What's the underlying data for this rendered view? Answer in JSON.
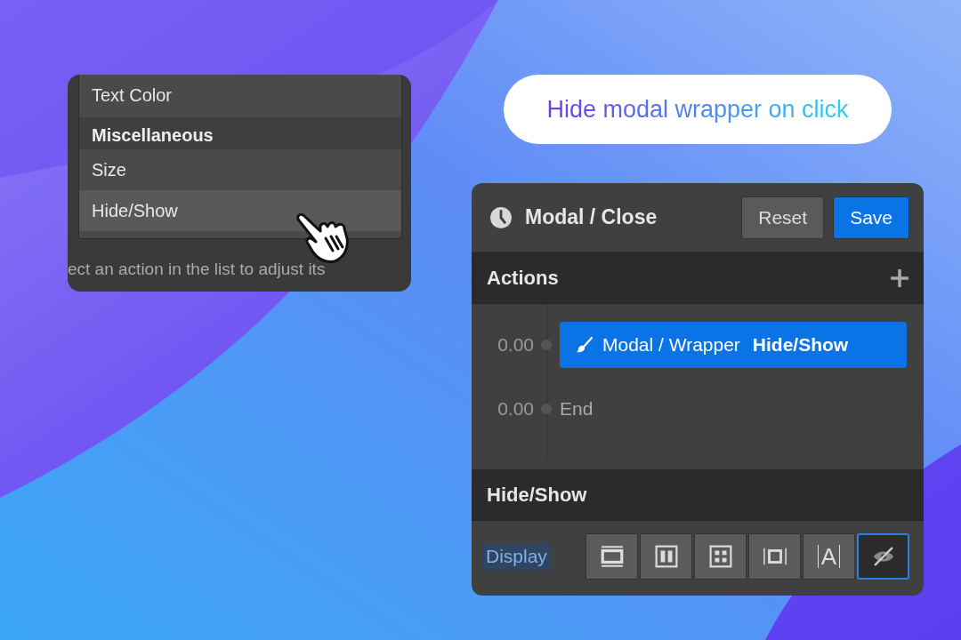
{
  "menu_card": {
    "items": [
      {
        "kind": "item",
        "label": "Text Color",
        "hovered": false
      },
      {
        "kind": "group",
        "label": "Miscellaneous"
      },
      {
        "kind": "item",
        "label": "Size",
        "hovered": false
      },
      {
        "kind": "item",
        "label": "Hide/Show",
        "hovered": true
      }
    ],
    "hint": "ect an action in the list to adjust its"
  },
  "caption": "Hide modal wrapper on click",
  "panel": {
    "title": "Modal / Close",
    "buttons": [
      {
        "label": "Reset",
        "kind": "secondary"
      },
      {
        "label": "Save",
        "kind": "primary"
      }
    ],
    "actions_header": "Actions",
    "timeline": [
      {
        "kind": "action",
        "time": "0.00",
        "target": "Modal / Wrapper",
        "action": "Hide/Show"
      },
      {
        "kind": "end",
        "time": "0.00",
        "label": "End"
      }
    ],
    "section_title": "Hide/Show",
    "display": {
      "label": "Display",
      "options": [
        {
          "kind": "block",
          "selected": false
        },
        {
          "kind": "flex",
          "selected": false
        },
        {
          "kind": "grid",
          "selected": false
        },
        {
          "kind": "inline-block",
          "selected": false
        },
        {
          "kind": "inline",
          "glyph": "A",
          "selected": false
        },
        {
          "kind": "none",
          "selected": true
        }
      ]
    }
  }
}
